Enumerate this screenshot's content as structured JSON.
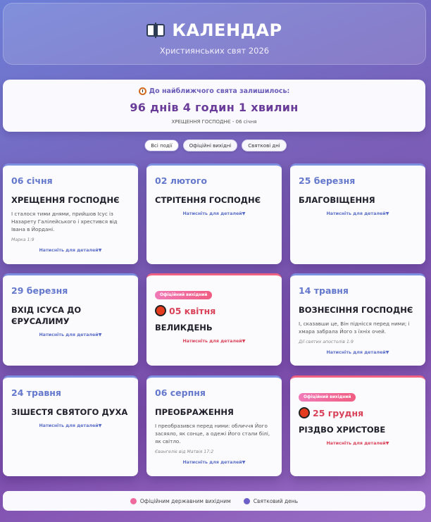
{
  "header": {
    "icon": "book-icon",
    "title": "КАЛЕНДАР",
    "subtitle": "Християнських свят 2026"
  },
  "countdown": {
    "icon": "alarm-clock-icon",
    "label": "До найближчого свята залишилось:",
    "timer": "96 днів 4 годин 1 хвилин",
    "next_holiday": "ХРЕЩЕННЯ ГОСПОДНЄ - 06 січня"
  },
  "filters": [
    {
      "label": "Всі події",
      "active": true
    },
    {
      "label": "Офіційні вихідні",
      "active": false
    },
    {
      "label": "Святкові дні",
      "active": false
    }
  ],
  "details_label": "Натисніть для деталей▼",
  "official_badge": "Офіційний вихідний",
  "cards": [
    {
      "date": "06 січня",
      "name": "ХРЕЩЕННЯ ГОСПОДНЄ",
      "quote": "І сталося тими днями, прийшов Ісус із Назарету Галілейського і хрестився від Івана в Йордані.",
      "source": "Марка 1:9",
      "official": false
    },
    {
      "date": "02 лютого",
      "name": "СТРІТЕННЯ ГОСПОДНЄ",
      "quote": "",
      "source": "",
      "official": false
    },
    {
      "date": "25 березня",
      "name": "БЛАГОВІЩЕННЯ",
      "quote": "",
      "source": "",
      "official": false
    },
    {
      "date": "29 березня",
      "name": "ВХІД ІСУСА ДО ЄРУСАЛИМУ",
      "quote": "",
      "source": "",
      "official": false
    },
    {
      "date": "05 квітня",
      "name": "ВЕЛИКДЕНЬ",
      "quote": "",
      "source": "",
      "official": true
    },
    {
      "date": "14 травня",
      "name": "ВОЗНЕСІННЯ ГОСПОДНЄ",
      "quote": "І, сказавши це, Він піднісся перед ними; і хмара забрала Його з їхніх очей.",
      "source": "Дії святих апостолів 1:9",
      "official": false
    },
    {
      "date": "24 травня",
      "name": "ЗІШЕСТЯ СВЯТОГО ДУХА",
      "quote": "",
      "source": "",
      "official": false
    },
    {
      "date": "06 серпня",
      "name": "ПРЕОБРАЖЕННЯ",
      "quote": "І преобразився перед ними: обличчя Його засяяло, як сонце, а одежі Його стали білі, як світло.",
      "source": "Євангеліє від Матвія 17:2",
      "official": false
    },
    {
      "date": "25 грудня",
      "name": "РІЗДВО ХРИСТОВЕ",
      "quote": "",
      "source": "",
      "official": true
    }
  ],
  "legend": [
    {
      "label": "Офіційним державним вихідним",
      "color": "#f06aa0"
    },
    {
      "label": "Святковий день",
      "color": "#6c5fc8"
    }
  ],
  "colors": {
    "accent": "#6478cc",
    "official": "#d9435a",
    "timer": "#6a3c99"
  }
}
